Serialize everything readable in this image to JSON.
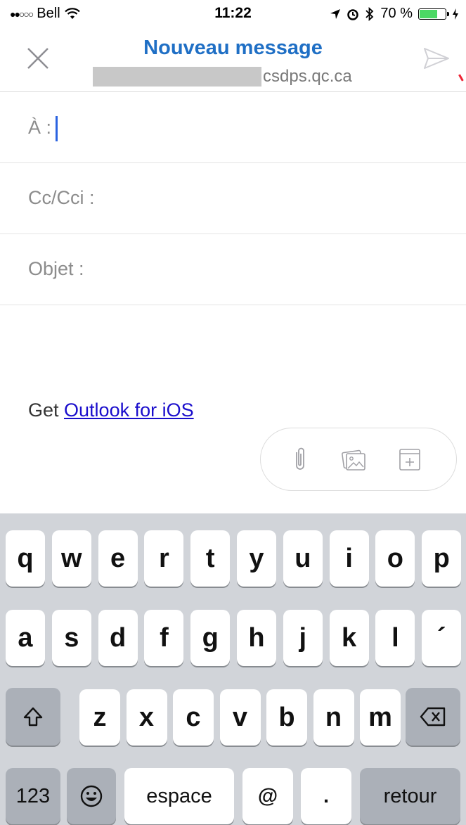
{
  "status_bar": {
    "signal": "●●○○○",
    "carrier": "Bell",
    "time": "11:22",
    "battery": "70 %",
    "battery_level": 0.7
  },
  "header": {
    "title": "Nouveau message",
    "account_domain": "csdps.qc.ca"
  },
  "fields": {
    "to_label": "À :",
    "cc_label": "Cc/Cci :",
    "subject_label": "Objet :"
  },
  "body": {
    "signature_prefix": "Get ",
    "signature_link": "Outlook for iOS"
  },
  "keyboard": {
    "row1": [
      "q",
      "w",
      "e",
      "r",
      "t",
      "y",
      "u",
      "i",
      "o",
      "p"
    ],
    "row2": [
      "a",
      "s",
      "d",
      "f",
      "g",
      "h",
      "j",
      "k",
      "l",
      "´"
    ],
    "row3": [
      "z",
      "x",
      "c",
      "v",
      "b",
      "n",
      "m"
    ],
    "numbers": "123",
    "space": "espace",
    "at": "@",
    "dot": ".",
    "return": "retour"
  },
  "colors": {
    "accent": "#1f6fc5",
    "link": "#1a0dcc",
    "caret": "#2b63e0"
  }
}
